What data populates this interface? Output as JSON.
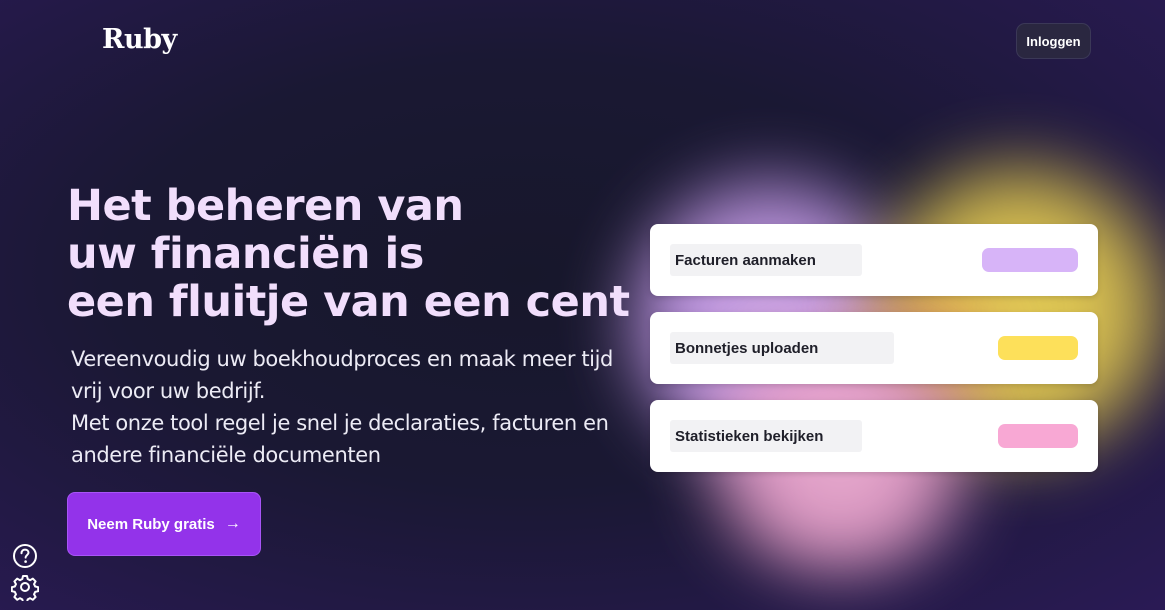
{
  "header": {
    "logo": "Ruby",
    "login_label": "Inloggen"
  },
  "hero": {
    "title_lines": [
      "Het beheren van",
      "uw financiën is",
      "een fluitje van een cent"
    ],
    "subtitle_lines": [
      "Vereenvoudig uw boekhoudproces en maak meer tijd",
      "vrij voor uw bedrijf.",
      "Met onze tool regel je snel je declaraties, facturen en",
      "andere financiële documenten"
    ],
    "cta_label": "Neem Ruby gratis",
    "cta_icon": "arrow-right-icon"
  },
  "features": [
    {
      "label": "Facturen aanmaken",
      "color": "#d7b4f8"
    },
    {
      "label": "Bonnetjes uploaden",
      "color": "#fde05a"
    },
    {
      "label": "Statistieken bekijken",
      "color": "#f8a8d4"
    }
  ],
  "sidebar_icons": [
    "help-icon",
    "settings-icon"
  ],
  "colors": {
    "accent": "#9333ea",
    "title": "#f1defc",
    "background": "#17172b"
  }
}
